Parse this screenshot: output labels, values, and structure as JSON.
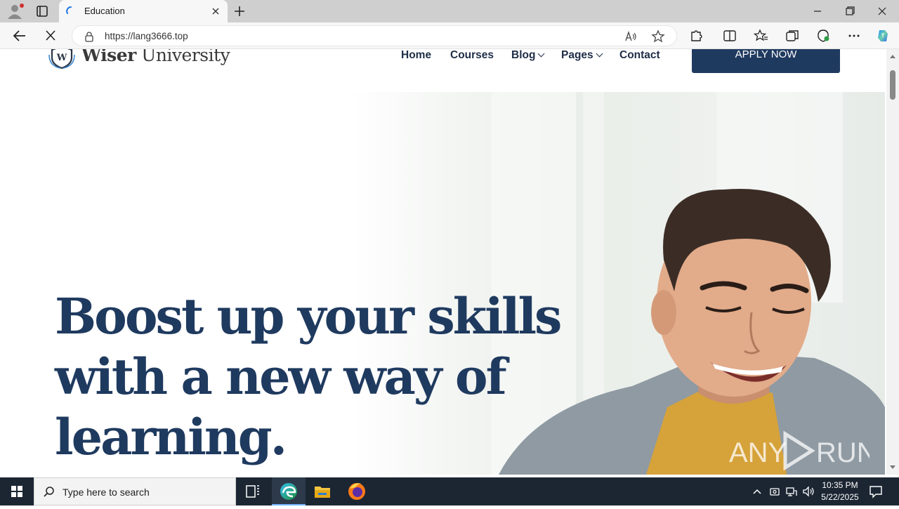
{
  "browser": {
    "tab_title": "Education",
    "url": "https://lang3666.top"
  },
  "site": {
    "logo_bold": "Wiser",
    "logo_rest": " University",
    "nav": {
      "home": "Home",
      "courses": "Courses",
      "blog": "Blog",
      "pages": "Pages",
      "contact": "Contact"
    },
    "apply_label": "APPLY NOW",
    "headline": [
      "Boost up your skills",
      "with a new way of",
      "learning."
    ]
  },
  "colors": {
    "brand_navy": "#1f3a5f",
    "taskbar": "#1c2633"
  },
  "watermark": {
    "left": "ANY",
    "right": "RUN"
  },
  "taskbar": {
    "search_placeholder": "Type here to search",
    "time": "10:35 PM",
    "date": "5/22/2025"
  }
}
